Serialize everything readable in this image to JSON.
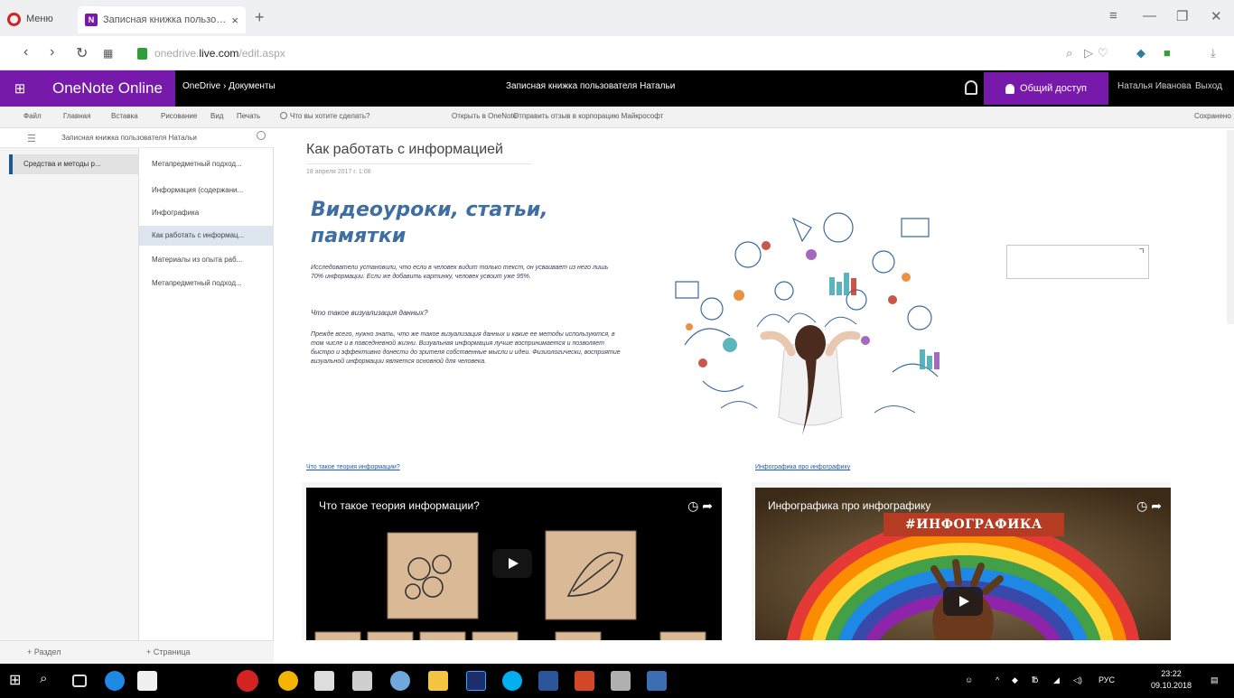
{
  "browser": {
    "menu_label": "Меню",
    "active_tab_title": "Записная книжка пользо…",
    "url_host_dim": "onedrive.",
    "url_host": "live.com",
    "url_path": "/edit.aspx",
    "new_tab_glyph": "+",
    "close_tab_glyph": "×"
  },
  "app": {
    "name": "OneNote Online",
    "breadcrumb": "OneDrive › Документы",
    "notebook_title": "Записная книжка пользователя Натальи",
    "share_label": "Общий доступ",
    "user_name": "Наталья Иванова",
    "signout_label": "Выход"
  },
  "ribbon": {
    "menu": [
      "Файл",
      "Главная",
      "Вставка",
      "Рисование",
      "Вид",
      "Печать"
    ],
    "tell_me": "Что вы хотите сделать?",
    "open_in": "Открыть в OneNote",
    "feedback": "Отправить отзыв в корпорацию Майкрософт",
    "saved": "Сохранено"
  },
  "nav": {
    "notebook_header": "Записная книжка пользователя Натальи",
    "section": "Средства и методы р...",
    "pages": [
      "Метапредметный подход...",
      "Информация (содержани...",
      "Инфографика",
      "Как работать с информац...",
      "Материалы из опыта раб...",
      "Метапредметный подход..."
    ],
    "selected_page_index": 3,
    "add_section": "+ Раздел",
    "add_page": "+ Страница"
  },
  "page": {
    "title": "Как работать с информацией",
    "date": "18 апреля 2017 г.   1:08",
    "heading": "Видеоуроки, статьи, памятки",
    "para1": "Исследователи установили, что если в человек видит только текст, он усваивает из него лишь 70% информации. Если же добавить картинку, человек усвоит уже 95%.",
    "para2": "Что такое визуализация данных?",
    "para3": "Прежде всего, нужно знать, что же такое визуализация данных и какие ее методы используются, в том числе и в повседневной жизни. Визуальная информация лучше воспринимается и позволяет быстро и эффективно донести до зрителя собственные мысли и идеи. Физиологически, восприятие визуальной информации является основной для человека."
  },
  "videos": [
    {
      "link_text": "Что такое теория информации?",
      "title": "Что такое теория информации?"
    },
    {
      "link_text": "Инфографика про инфографику",
      "title": "Инфографика про инфографику",
      "hashtag": "#ИНФОГРАФИКА"
    }
  ],
  "taskbar": {
    "lang": "РУС",
    "time": "23:22",
    "date": "09.10.2018"
  },
  "colors": {
    "onenote_purple": "#7719aa",
    "heading_blue": "#3f6ea2",
    "link_blue": "#1e5bb5"
  }
}
